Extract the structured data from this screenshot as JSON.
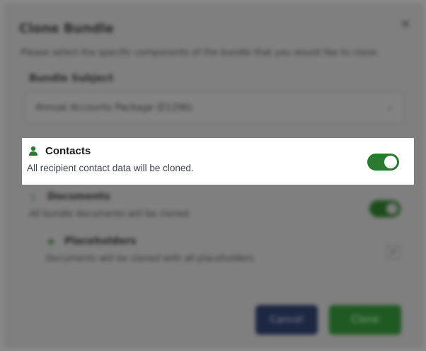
{
  "modal": {
    "title": "Clone Bundle",
    "description": "Please select the specific components of the bundle that you would like to clone.",
    "close_glyph": "✕"
  },
  "bundle": {
    "label": "Bundle Subject",
    "selected_value": "Annual Accounts Package (E1296)",
    "chevron_glyph": "⌄"
  },
  "contacts": {
    "title": "Contacts",
    "description": "All recipient contact data will be cloned.",
    "enabled": true,
    "icon": "person-icon",
    "accent_color": "#2c7a2f"
  },
  "documents": {
    "title": "Documents",
    "description": "All bundle documents will be cloned.",
    "enabled": true,
    "icon_glyph": "▯"
  },
  "placeholders": {
    "title": "Placeholders",
    "description": "Documents will be cloned with all placeholders",
    "checked": true,
    "icon_glyph": "◆",
    "check_glyph": "✓"
  },
  "actions": {
    "cancel_label": "Cancel",
    "clone_label": "Clone"
  }
}
